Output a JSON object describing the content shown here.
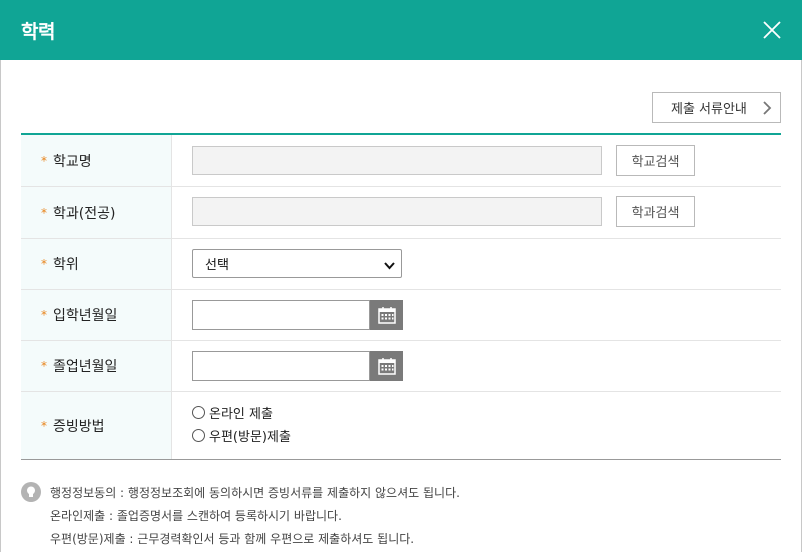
{
  "dialog": {
    "title": "학력",
    "close_icon": "close-icon"
  },
  "guide_button": {
    "label": "제출 서류안내"
  },
  "form": {
    "school_name": {
      "label": "학교명",
      "value": "",
      "search_label": "학교검색"
    },
    "department": {
      "label": "학과(전공)",
      "value": "",
      "search_label": "학과검색"
    },
    "degree": {
      "label": "학위",
      "selected": "선택"
    },
    "admission_date": {
      "label": "입학년월일",
      "value": ""
    },
    "graduation_date": {
      "label": "졸업년월일",
      "value": ""
    },
    "proof_method": {
      "label": "증빙방법",
      "options": [
        "온라인 제출",
        "우편(방문)제출"
      ]
    }
  },
  "notes": [
    "행정정보동의 : 행정정보조회에 동의하시면 증빙서류를 제출하지 않으셔도 됩니다.",
    "온라인제출 : 졸업증명서를 스캔하여 등록하시기 바랍니다.",
    "우편(방문)제출 : 근무경력확인서 등과 함께 우편으로 제출하셔도 됩니다."
  ],
  "colors": {
    "accent": "#10a595",
    "required_star": "#e8841c",
    "label_bg": "#f4fbfb"
  }
}
